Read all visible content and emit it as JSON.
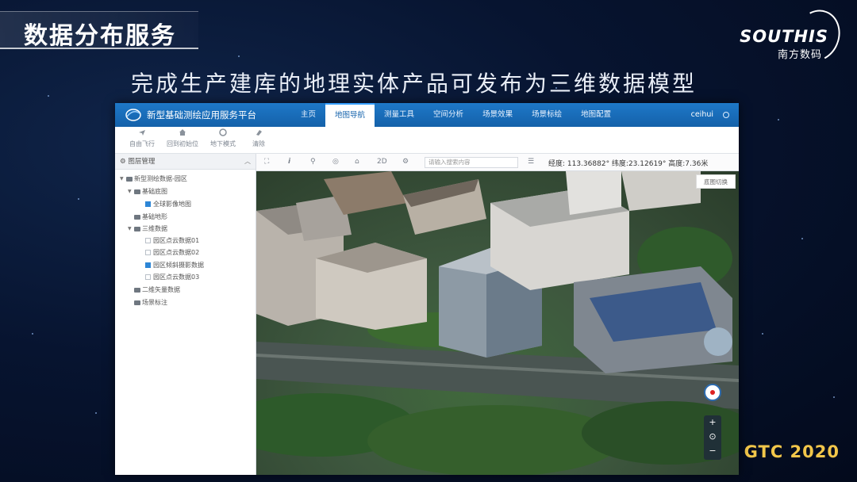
{
  "slide": {
    "title": "数据分布服务",
    "subtitle": "完成生产建库的地理实体产品可发布为三维数据模型",
    "brand_name": "SOUTHIS",
    "brand_sub": "南方数码",
    "event": "GTC 2020"
  },
  "app": {
    "title": "新型基础测绘应用服务平台",
    "nav": [
      {
        "label": "主页",
        "active": false
      },
      {
        "label": "地图导航",
        "active": true
      },
      {
        "label": "测量工具",
        "active": false
      },
      {
        "label": "空间分析",
        "active": false
      },
      {
        "label": "场景效果",
        "active": false
      },
      {
        "label": "场景标绘",
        "active": false
      },
      {
        "label": "地图配置",
        "active": false
      }
    ],
    "user": "ceihui",
    "toolbar": [
      {
        "label": "自由飞行",
        "icon": "plane-icon"
      },
      {
        "label": "回到初始位",
        "icon": "home-icon"
      },
      {
        "label": "地下模式",
        "icon": "layers-icon"
      },
      {
        "label": "清除",
        "icon": "eraser-icon"
      }
    ],
    "sidebar": {
      "title": "图层管理",
      "tree": [
        {
          "label": "新型测绘数据-园区",
          "level": 0,
          "type": "folder"
        },
        {
          "label": "基础底图",
          "level": 1,
          "type": "folder"
        },
        {
          "label": "全球影像地图",
          "level": 2,
          "type": "check",
          "checked": true
        },
        {
          "label": "基础地形",
          "level": 1,
          "type": "folder"
        },
        {
          "label": "三维数据",
          "level": 1,
          "type": "folder"
        },
        {
          "label": "园区点云数据01",
          "level": 2,
          "type": "check",
          "checked": false
        },
        {
          "label": "园区点云数据02",
          "level": 2,
          "type": "check",
          "checked": false
        },
        {
          "label": "园区倾斜摄影数据",
          "level": 2,
          "type": "check",
          "checked": true
        },
        {
          "label": "园区点云数据03",
          "level": 2,
          "type": "check",
          "checked": false
        },
        {
          "label": "二维矢量数据",
          "level": 1,
          "type": "folder"
        },
        {
          "label": "场景标注",
          "level": 1,
          "type": "folder"
        }
      ]
    },
    "map_bar": {
      "mode_2d": "2D",
      "search_placeholder": "请输入搜索内容",
      "coords": "经度: 113.36882°  纬度:23.12619°  高度:7.36米"
    },
    "map": {
      "layer_button": "底图切换",
      "zoom_in": "+",
      "reset": "⊙",
      "zoom_out": "−"
    }
  }
}
